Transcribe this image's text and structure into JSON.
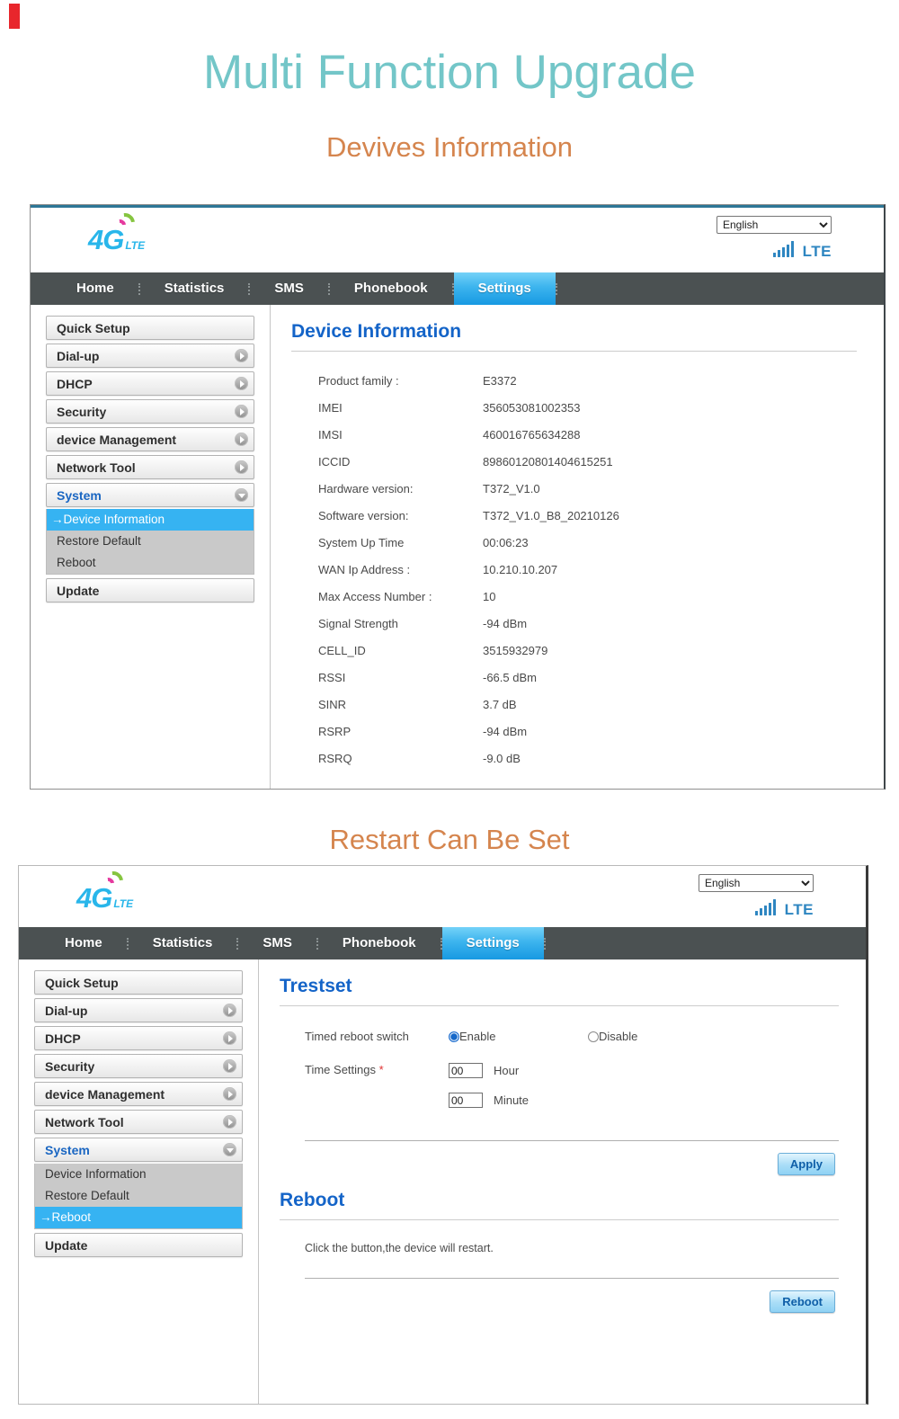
{
  "page": {
    "title": "Multi Function Upgrade",
    "section1_title": "Devives Information",
    "section2_title": "Restart Can Be Set"
  },
  "colors": {
    "title_teal": "#73c6c8",
    "subtitle_orange": "#d5854e",
    "navbar_gray": "#4b5152",
    "active_tab_blue": "#1799e2",
    "heading_blue": "#1464c8",
    "selected_item_blue": "#36b3f2",
    "logo_blue": "#29b6ea",
    "signal_blue": "#2e86c1"
  },
  "shared": {
    "logo_text": "4G",
    "logo_sub": "LTE",
    "language_selected": "English",
    "network_label": "LTE",
    "nav_tabs": [
      "Home",
      "Statistics",
      "SMS",
      "Phonebook",
      "Settings"
    ],
    "active_tab": "Settings"
  },
  "sidebar1": {
    "items": [
      {
        "label": "Quick Setup"
      },
      {
        "label": "Dial-up",
        "arrow": "right"
      },
      {
        "label": "DHCP",
        "arrow": "right"
      },
      {
        "label": "Security",
        "arrow": "right"
      },
      {
        "label": "device Management",
        "arrow": "right"
      },
      {
        "label": "Network Tool",
        "arrow": "right"
      },
      {
        "label": "System",
        "arrow": "down",
        "open": true
      }
    ],
    "submenu": [
      {
        "label": "Device Information",
        "selected": true,
        "prefix": "→"
      },
      {
        "label": "Restore Default"
      },
      {
        "label": "Reboot"
      }
    ],
    "bottom_item": {
      "label": "Update"
    }
  },
  "sidebar2": {
    "items": [
      {
        "label": "Quick Setup"
      },
      {
        "label": "Dial-up",
        "arrow": "right"
      },
      {
        "label": "DHCP",
        "arrow": "right"
      },
      {
        "label": "Security",
        "arrow": "right"
      },
      {
        "label": "device Management",
        "arrow": "right"
      },
      {
        "label": "Network Tool",
        "arrow": "right"
      },
      {
        "label": "System",
        "arrow": "down",
        "open": true
      }
    ],
    "submenu": [
      {
        "label": "Device Information"
      },
      {
        "label": "Restore Default"
      },
      {
        "label": "Reboot",
        "selected": true,
        "prefix": "→"
      }
    ],
    "bottom_item": {
      "label": "Update"
    }
  },
  "screen1": {
    "title": "Device Information",
    "rows": [
      {
        "label": "Product family :",
        "value": "E3372"
      },
      {
        "label": "IMEI",
        "value": "356053081002353"
      },
      {
        "label": "IMSI",
        "value": "460016765634288"
      },
      {
        "label": "ICCID",
        "value": "89860120801404615251"
      },
      {
        "label": "Hardware version:",
        "value": "T372_V1.0"
      },
      {
        "label": "Software version:",
        "value": "T372_V1.0_B8_20210126"
      },
      {
        "label": "System Up Time",
        "value": "00:06:23"
      },
      {
        "label": "WAN Ip Address :",
        "value": "10.210.10.207"
      },
      {
        "label": "Max Access Number :",
        "value": "10"
      },
      {
        "label": "Signal Strength",
        "value": "-94 dBm"
      },
      {
        "label": "CELL_ID",
        "value": "3515932979"
      },
      {
        "label": "RSSI",
        "value": "-66.5 dBm"
      },
      {
        "label": "SINR",
        "value": "3.7 dB"
      },
      {
        "label": "RSRP",
        "value": "-94 dBm"
      },
      {
        "label": "RSRQ",
        "value": "-9.0 dB"
      }
    ]
  },
  "screen2": {
    "trestset": {
      "title": "Trestset",
      "timed_reboot_label": "Timed reboot switch",
      "enable_label": "Enable",
      "disable_label": "Disable",
      "time_settings_label": "Time Settings ",
      "required_mark": "*",
      "hour_value": "00",
      "hour_label": "Hour",
      "minute_value": "00",
      "minute_label": "Minute",
      "apply_button": "Apply"
    },
    "reboot": {
      "title": "Reboot",
      "description": "Click the button,the device will restart.",
      "reboot_button": "Reboot"
    }
  }
}
